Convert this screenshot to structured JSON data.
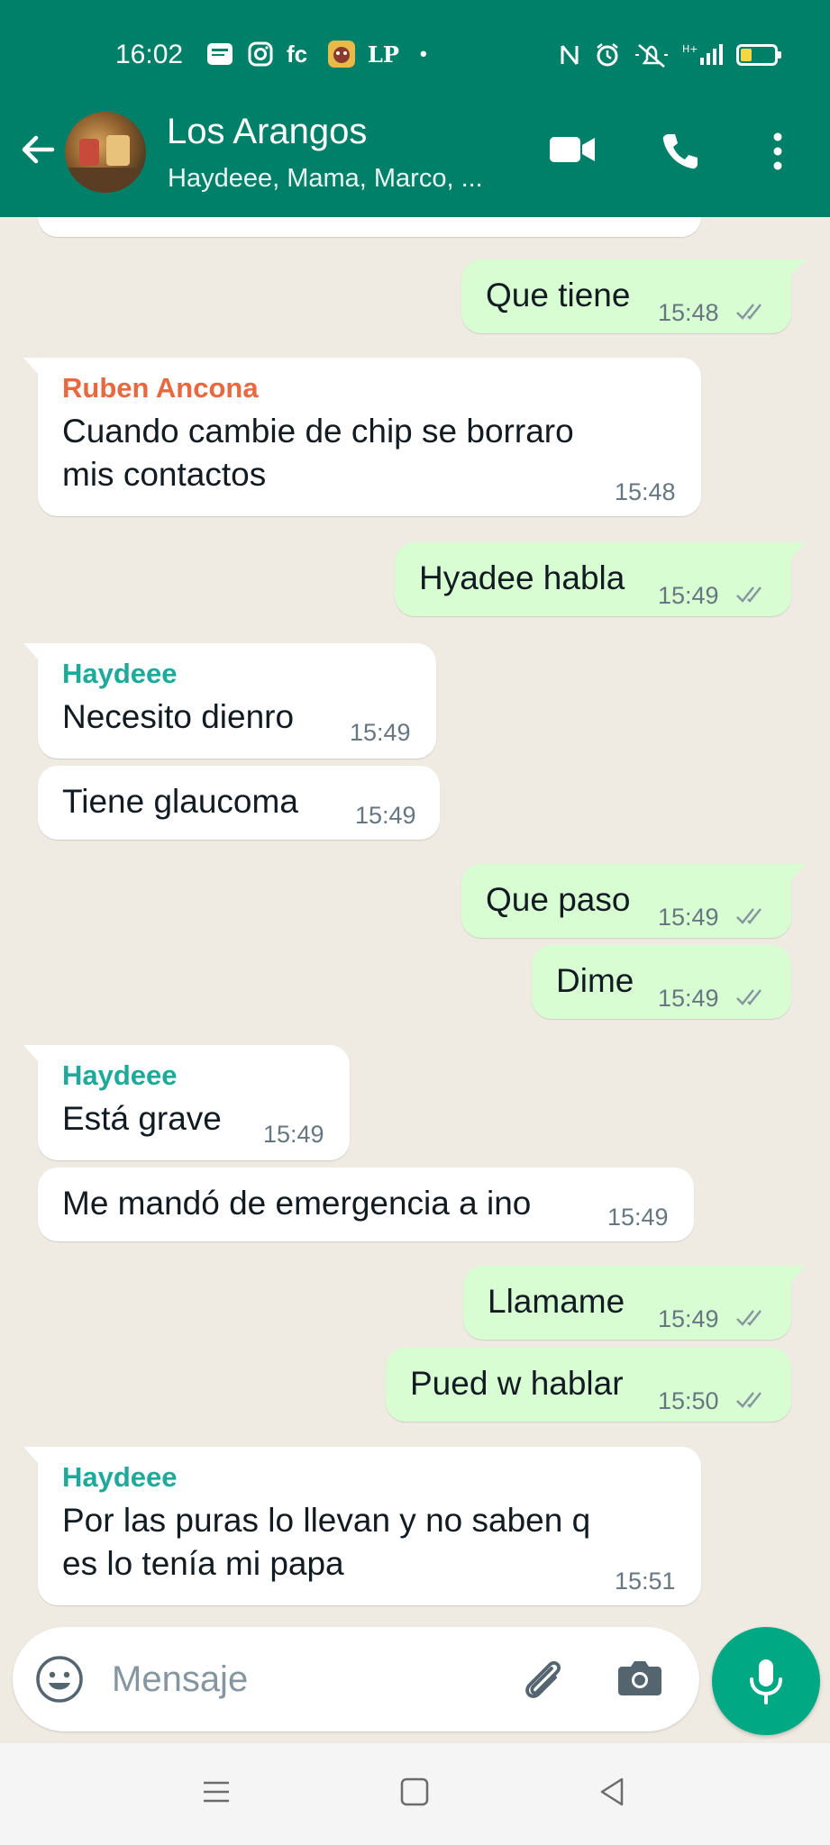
{
  "status_bar": {
    "time": "16:02",
    "app_icons": [
      "news-icon",
      "instagram-icon",
      "fc",
      "game-icon",
      "LP",
      "dot"
    ],
    "fc_label": "fc",
    "lp_label": "LP",
    "dot_label": "•",
    "right_icons": [
      "nfc-icon",
      "alarm-icon",
      "silent-icon",
      "signal-icon",
      "battery-icon"
    ]
  },
  "header": {
    "title": "Los Arangos",
    "subtitle": "Haydeee, Mama, Marco, ..."
  },
  "messages": [
    {
      "dir": "out",
      "text": "Que tiene",
      "time": "15:48",
      "read": true
    },
    {
      "dir": "in",
      "sender": "Ruben Ancona",
      "sender_color": "#e8683f",
      "text": "Cuando cambie de chip se borraro\nmis contactos",
      "time": "15:48"
    },
    {
      "dir": "out",
      "text": "Hyadee habla",
      "time": "15:49",
      "read": true
    },
    {
      "dir": "in",
      "sender": "Haydeee",
      "sender_color": "#1fa99a",
      "text": "Necesito dienro",
      "time": "15:49"
    },
    {
      "dir": "in",
      "text": "Tiene glaucoma",
      "time": "15:49"
    },
    {
      "dir": "out",
      "text": "Que paso",
      "time": "15:49",
      "read": true
    },
    {
      "dir": "out",
      "text": "Dime",
      "time": "15:49",
      "read": true
    },
    {
      "dir": "in",
      "sender": "Haydeee",
      "sender_color": "#1fa99a",
      "text": "Está grave",
      "time": "15:49"
    },
    {
      "dir": "in",
      "text": "Me mandó de emergencia a ino",
      "time": "15:49"
    },
    {
      "dir": "out",
      "text": "Llamame",
      "time": "15:49",
      "read": true
    },
    {
      "dir": "out",
      "text": "Pued w hablar",
      "time": "15:50",
      "read": true
    },
    {
      "dir": "in",
      "sender": "Haydeee",
      "sender_color": "#1fa99a",
      "text": "Por las puras lo llevan y no saben q\nes lo tenía mi papa",
      "time": "15:51"
    }
  ],
  "composer": {
    "placeholder": "Mensaje"
  },
  "colors": {
    "header": "#008069",
    "outgoing_bubble": "#d9fdd3",
    "incoming_bubble": "#ffffff",
    "read_ticks": "#8696a0",
    "mic_button": "#00a884"
  }
}
